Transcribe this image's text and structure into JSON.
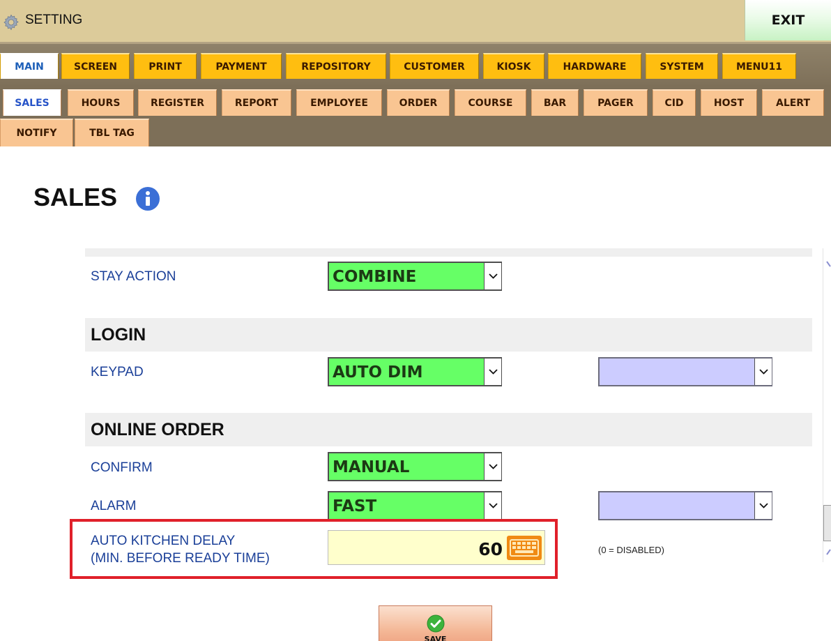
{
  "window": {
    "title": "SETTING",
    "exit_label": "EXIT"
  },
  "main_tabs": [
    {
      "label": "MAIN",
      "active": true
    },
    {
      "label": "SCREEN"
    },
    {
      "label": "PRINT"
    },
    {
      "label": "PAYMENT"
    },
    {
      "label": "REPOSITORY"
    },
    {
      "label": "CUSTOMER"
    },
    {
      "label": "KIOSK"
    },
    {
      "label": "HARDWARE"
    },
    {
      "label": "SYSTEM"
    },
    {
      "label": "MENU11"
    }
  ],
  "sub_tabs": [
    {
      "label": "SALES",
      "active": true
    },
    {
      "label": "HOURS"
    },
    {
      "label": "REGISTER"
    },
    {
      "label": "REPORT"
    },
    {
      "label": "EMPLOYEE"
    },
    {
      "label": "ORDER"
    },
    {
      "label": "COURSE"
    },
    {
      "label": "BAR"
    },
    {
      "label": "PAGER"
    },
    {
      "label": "CID"
    },
    {
      "label": "HOST"
    },
    {
      "label": "ALERT"
    },
    {
      "label": "NOTIFY"
    },
    {
      "label": "TBL TAG"
    }
  ],
  "page": {
    "title": "SALES"
  },
  "settings": {
    "stay_action": {
      "label": "STAY ACTION",
      "value": "COMBINE"
    },
    "login": {
      "heading": "LOGIN",
      "keypad": {
        "label": "KEYPAD",
        "value": "AUTO DIM",
        "secondary_value": ""
      }
    },
    "online_order": {
      "heading": "ONLINE ORDER",
      "confirm": {
        "label": "CONFIRM",
        "value": "MANUAL"
      },
      "alarm": {
        "label": "ALARM",
        "value": "FAST",
        "secondary_value": ""
      },
      "auto_kitchen_delay": {
        "label_line1": "AUTO KITCHEN DELAY",
        "label_line2": "(MIN. BEFORE READY TIME)",
        "value": "60",
        "hint": "(0 = DISABLED)"
      }
    }
  },
  "footer": {
    "save_label": "SAVE"
  },
  "colors": {
    "title_bar": "#dccb9a",
    "tab_main": "#ffbe10",
    "tab_sub": "#f9c592",
    "select_green": "#66ff66",
    "select_lavender": "#ccccff",
    "input_yellow": "#ffffcc",
    "label_blue": "#1a3f98",
    "highlight_red": "#e0202a"
  }
}
